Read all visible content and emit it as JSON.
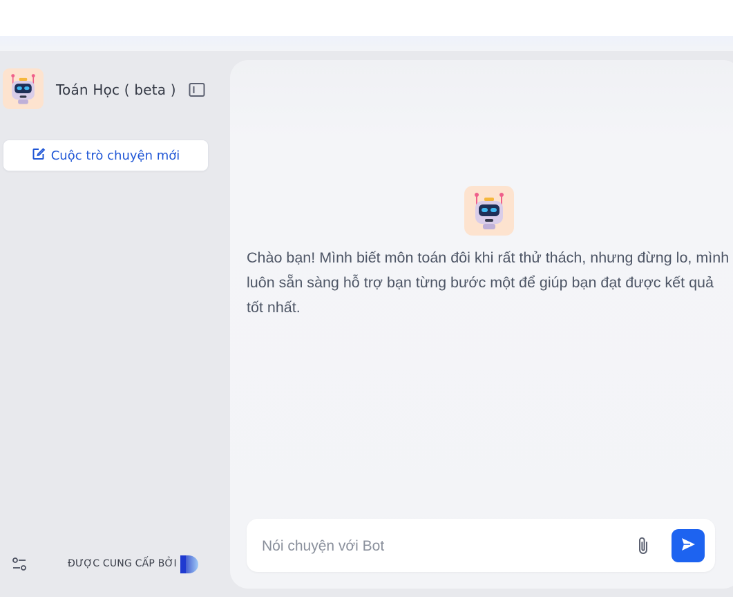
{
  "sidebar": {
    "bot_name": "Toán Học ( beta )",
    "new_chat_label": "Cuộc trò chuyện mới",
    "provided_by_label": "ĐƯỢC CUNG CẤP BỞI"
  },
  "chat": {
    "greeting": "Chào bạn! Mình biết môn toán đôi khi rất thử thách, nhưng đừng lo, mình luôn sẵn sàng hỗ trợ bạn từng bước một để giúp bạn đạt được kết quả tốt nhất.",
    "input_placeholder": "Nói chuyện với Bot",
    "input_value": ""
  },
  "icons": {
    "bot_avatar": "robot-icon",
    "sidebar_toggle": "sidebar-toggle-icon",
    "new_chat": "edit-icon",
    "settings": "settings-sliders-icon",
    "attach": "paperclip-icon",
    "send": "send-icon",
    "brand": "brand-logo"
  },
  "colors": {
    "accent": "#1d63f0",
    "new_chat_text": "#1f56d6",
    "sidebar_bg": "#e8e9ed",
    "chat_bg": "#f3f4f7",
    "avatar_bg": "#fde3cf"
  }
}
